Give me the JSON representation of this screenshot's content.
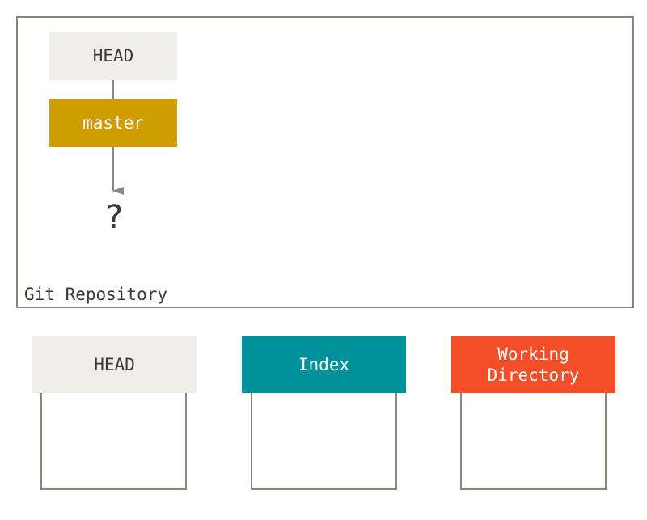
{
  "repository": {
    "label": "Git Repository",
    "head_label": "HEAD",
    "branch_label": "master",
    "unknown_commit": "?"
  },
  "areas": [
    {
      "label": "HEAD",
      "color": "#efeee8",
      "text_color": "#3c3a35"
    },
    {
      "label": "Index",
      "color": "#00909a",
      "text_color": "#ffffff"
    },
    {
      "label": "Working\nDirectory",
      "color": "#f24e27",
      "text_color": "#ffffff"
    }
  ],
  "colors": {
    "frame": "#8a877d",
    "branch": "#cf9d00",
    "text": "#3c3a35"
  }
}
